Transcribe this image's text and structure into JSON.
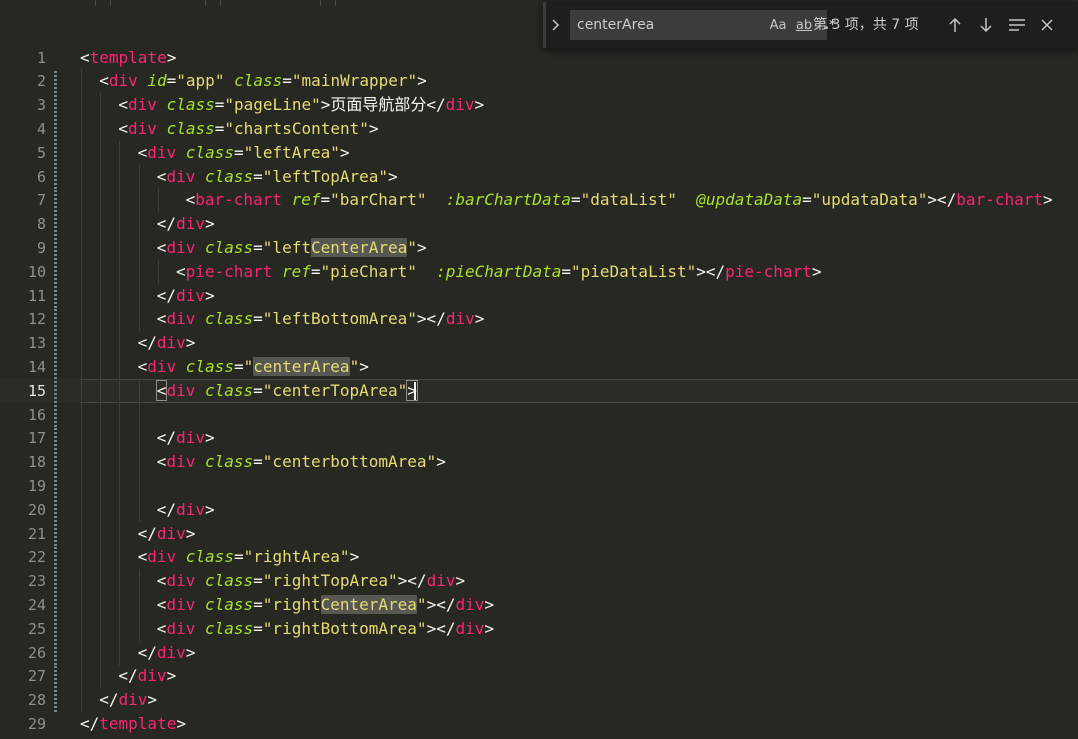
{
  "find_widget": {
    "search_value": "centerArea",
    "match_case_label": "Aa",
    "whole_word_label": "ab",
    "regex_label": ".*",
    "match_count": "第 3 项，共 7 项"
  },
  "editor": {
    "current_line": 15,
    "lines": [
      {
        "n": "1",
        "indent": 0,
        "toks": [
          [
            "p",
            "<"
          ],
          [
            "tag",
            "template"
          ],
          [
            "p",
            ">"
          ]
        ]
      },
      {
        "n": "2",
        "indent": 1,
        "toks": [
          [
            "p",
            "<"
          ],
          [
            "tag",
            "div"
          ],
          [
            "p",
            " "
          ],
          [
            "attr",
            "id"
          ],
          [
            "p",
            "="
          ],
          [
            "str",
            "\"app\""
          ],
          [
            "p",
            " "
          ],
          [
            "attr",
            "class"
          ],
          [
            "p",
            "="
          ],
          [
            "str",
            "\"mainWrapper\""
          ],
          [
            "p",
            ">"
          ]
        ]
      },
      {
        "n": "3",
        "indent": 2,
        "toks": [
          [
            "p",
            "<"
          ],
          [
            "tag",
            "div"
          ],
          [
            "p",
            " "
          ],
          [
            "attr",
            "class"
          ],
          [
            "p",
            "="
          ],
          [
            "str",
            "\"pageLine\""
          ],
          [
            "p",
            ">"
          ],
          [
            "txt",
            "页面导航部分"
          ],
          [
            "p",
            "</"
          ],
          [
            "tag",
            "div"
          ],
          [
            "p",
            ">"
          ]
        ]
      },
      {
        "n": "4",
        "indent": 2,
        "toks": [
          [
            "p",
            "<"
          ],
          [
            "tag",
            "div"
          ],
          [
            "p",
            " "
          ],
          [
            "attr",
            "class"
          ],
          [
            "p",
            "="
          ],
          [
            "str",
            "\"chartsContent\""
          ],
          [
            "p",
            ">"
          ]
        ]
      },
      {
        "n": "5",
        "indent": 3,
        "toks": [
          [
            "p",
            "<"
          ],
          [
            "tag",
            "div"
          ],
          [
            "p",
            " "
          ],
          [
            "attr",
            "class"
          ],
          [
            "p",
            "="
          ],
          [
            "str",
            "\"leftArea\""
          ],
          [
            "p",
            ">"
          ]
        ]
      },
      {
        "n": "6",
        "indent": 4,
        "toks": [
          [
            "p",
            "<"
          ],
          [
            "tag",
            "div"
          ],
          [
            "p",
            " "
          ],
          [
            "attr",
            "class"
          ],
          [
            "p",
            "="
          ],
          [
            "str",
            "\"leftTopArea\""
          ],
          [
            "p",
            ">"
          ]
        ]
      },
      {
        "n": "7",
        "indent": 5.5,
        "toks": [
          [
            "p",
            "<"
          ],
          [
            "tag",
            "bar-chart"
          ],
          [
            "p",
            " "
          ],
          [
            "attr",
            "ref"
          ],
          [
            "p",
            "="
          ],
          [
            "str",
            "\"barChart\""
          ],
          [
            "p",
            "  "
          ],
          [
            "attr",
            ":barChartData"
          ],
          [
            "p",
            "="
          ],
          [
            "str",
            "\"dataList\""
          ],
          [
            "p",
            "  "
          ],
          [
            "attr",
            "@updataData"
          ],
          [
            "p",
            "="
          ],
          [
            "str",
            "\"updataData\""
          ],
          [
            "p",
            "></"
          ],
          [
            "tag",
            "bar-chart"
          ],
          [
            "p",
            ">"
          ]
        ]
      },
      {
        "n": "8",
        "indent": 4,
        "toks": [
          [
            "p",
            "</"
          ],
          [
            "tag",
            "div"
          ],
          [
            "p",
            ">"
          ]
        ]
      },
      {
        "n": "9",
        "indent": 4,
        "toks": [
          [
            "p",
            "<"
          ],
          [
            "tag",
            "div"
          ],
          [
            "p",
            " "
          ],
          [
            "attr",
            "class"
          ],
          [
            "p",
            "="
          ],
          [
            "str",
            "\"left"
          ],
          [
            "strhl",
            "CenterArea"
          ],
          [
            "str",
            "\""
          ],
          [
            "p",
            ">"
          ]
        ]
      },
      {
        "n": "10",
        "indent": 5,
        "toks": [
          [
            "p",
            "<"
          ],
          [
            "tag",
            "pie-chart"
          ],
          [
            "p",
            " "
          ],
          [
            "attr",
            "ref"
          ],
          [
            "p",
            "="
          ],
          [
            "str",
            "\"pieChart\""
          ],
          [
            "p",
            "  "
          ],
          [
            "attr",
            ":pieChartData"
          ],
          [
            "p",
            "="
          ],
          [
            "str",
            "\"pieDataList\""
          ],
          [
            "p",
            "></"
          ],
          [
            "tag",
            "pie-chart"
          ],
          [
            "p",
            ">"
          ]
        ]
      },
      {
        "n": "11",
        "indent": 4,
        "toks": [
          [
            "p",
            "</"
          ],
          [
            "tag",
            "div"
          ],
          [
            "p",
            ">"
          ]
        ]
      },
      {
        "n": "12",
        "indent": 4,
        "toks": [
          [
            "p",
            "<"
          ],
          [
            "tag",
            "div"
          ],
          [
            "p",
            " "
          ],
          [
            "attr",
            "class"
          ],
          [
            "p",
            "="
          ],
          [
            "str",
            "\"leftBottomArea\""
          ],
          [
            "p",
            "></"
          ],
          [
            "tag",
            "div"
          ],
          [
            "p",
            ">"
          ]
        ]
      },
      {
        "n": "13",
        "indent": 3,
        "toks": [
          [
            "p",
            "</"
          ],
          [
            "tag",
            "div"
          ],
          [
            "p",
            ">"
          ]
        ]
      },
      {
        "n": "14",
        "indent": 3,
        "toks": [
          [
            "p",
            "<"
          ],
          [
            "tag",
            "div"
          ],
          [
            "p",
            " "
          ],
          [
            "attr",
            "class"
          ],
          [
            "p",
            "="
          ],
          [
            "str",
            "\""
          ],
          [
            "strhl",
            "centerArea"
          ],
          [
            "str",
            "\""
          ],
          [
            "p",
            ">"
          ]
        ]
      },
      {
        "n": "15",
        "indent": 4,
        "toks": [
          [
            "pbox",
            "<"
          ],
          [
            "tag",
            "div"
          ],
          [
            "p",
            " "
          ],
          [
            "attr",
            "class"
          ],
          [
            "p",
            "="
          ],
          [
            "str",
            "\"centerTopArea\""
          ],
          [
            "pbox",
            ">"
          ]
        ]
      },
      {
        "n": "16",
        "indent": 4,
        "toks": []
      },
      {
        "n": "17",
        "indent": 4,
        "toks": [
          [
            "p",
            "</"
          ],
          [
            "tag",
            "div"
          ],
          [
            "p",
            ">"
          ]
        ]
      },
      {
        "n": "18",
        "indent": 4,
        "toks": [
          [
            "p",
            "<"
          ],
          [
            "tag",
            "div"
          ],
          [
            "p",
            " "
          ],
          [
            "attr",
            "class"
          ],
          [
            "p",
            "="
          ],
          [
            "str",
            "\"centerbottomArea\""
          ],
          [
            "p",
            ">"
          ]
        ]
      },
      {
        "n": "19",
        "indent": 4,
        "toks": []
      },
      {
        "n": "20",
        "indent": 4,
        "toks": [
          [
            "p",
            "</"
          ],
          [
            "tag",
            "div"
          ],
          [
            "p",
            ">"
          ]
        ]
      },
      {
        "n": "21",
        "indent": 3,
        "toks": [
          [
            "p",
            "</"
          ],
          [
            "tag",
            "div"
          ],
          [
            "p",
            ">"
          ]
        ]
      },
      {
        "n": "22",
        "indent": 3,
        "toks": [
          [
            "p",
            "<"
          ],
          [
            "tag",
            "div"
          ],
          [
            "p",
            " "
          ],
          [
            "attr",
            "class"
          ],
          [
            "p",
            "="
          ],
          [
            "str",
            "\"rightArea\""
          ],
          [
            "p",
            ">"
          ]
        ]
      },
      {
        "n": "23",
        "indent": 4,
        "toks": [
          [
            "p",
            "<"
          ],
          [
            "tag",
            "div"
          ],
          [
            "p",
            " "
          ],
          [
            "attr",
            "class"
          ],
          [
            "p",
            "="
          ],
          [
            "str",
            "\"rightTopArea\""
          ],
          [
            "p",
            "></"
          ],
          [
            "tag",
            "div"
          ],
          [
            "p",
            ">"
          ]
        ]
      },
      {
        "n": "24",
        "indent": 4,
        "toks": [
          [
            "p",
            "<"
          ],
          [
            "tag",
            "div"
          ],
          [
            "p",
            " "
          ],
          [
            "attr",
            "class"
          ],
          [
            "p",
            "="
          ],
          [
            "str",
            "\"right"
          ],
          [
            "strhl",
            "CenterArea"
          ],
          [
            "str",
            "\""
          ],
          [
            "p",
            "></"
          ],
          [
            "tag",
            "div"
          ],
          [
            "p",
            ">"
          ]
        ]
      },
      {
        "n": "25",
        "indent": 4,
        "toks": [
          [
            "p",
            "<"
          ],
          [
            "tag",
            "div"
          ],
          [
            "p",
            " "
          ],
          [
            "attr",
            "class"
          ],
          [
            "p",
            "="
          ],
          [
            "str",
            "\"rightBottomArea\""
          ],
          [
            "p",
            "></"
          ],
          [
            "tag",
            "div"
          ],
          [
            "p",
            ">"
          ]
        ]
      },
      {
        "n": "26",
        "indent": 3,
        "toks": [
          [
            "p",
            "</"
          ],
          [
            "tag",
            "div"
          ],
          [
            "p",
            ">"
          ]
        ]
      },
      {
        "n": "27",
        "indent": 2,
        "toks": [
          [
            "p",
            "</"
          ],
          [
            "tag",
            "div"
          ],
          [
            "p",
            ">"
          ]
        ]
      },
      {
        "n": "28",
        "indent": 1,
        "toks": [
          [
            "p",
            "</"
          ],
          [
            "tag",
            "div"
          ],
          [
            "p",
            ">"
          ]
        ]
      },
      {
        "n": "29",
        "indent": 0,
        "toks": [
          [
            "p",
            "</"
          ],
          [
            "tag",
            "template"
          ],
          [
            "p",
            ">"
          ]
        ]
      }
    ]
  }
}
